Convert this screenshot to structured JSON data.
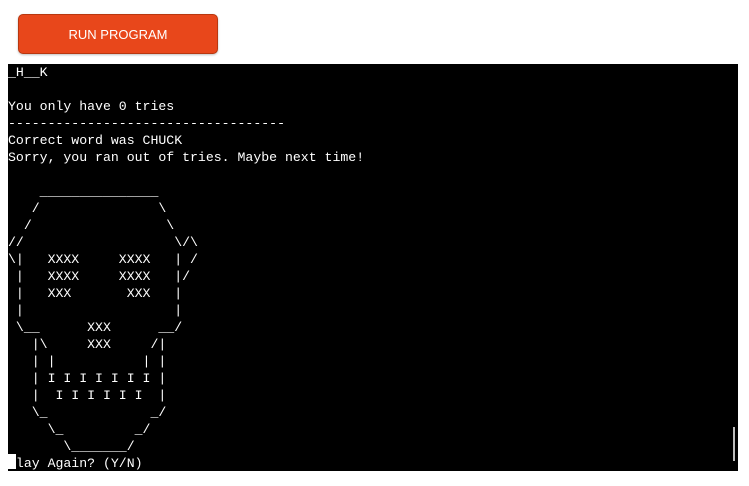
{
  "run_button": {
    "label": "RUN PROGRAM"
  },
  "terminal": {
    "lines": [
      "_H__K",
      "",
      "You only have 0 tries",
      "-----------------------------------",
      "Correct word was CHUCK",
      "Sorry, you ran out of tries. Maybe next time!",
      "",
      "    _______________",
      "   /               \\",
      "  /                 \\",
      "//                   \\/\\",
      "\\|   XXXX     XXXX   | /",
      " |   XXXX     XXXX   |/",
      " |   XXX       XXX   |",
      " |                   |",
      " \\__      XXX      __/",
      "   |\\     XXX     /|",
      "   | |           | |",
      "   | I I I I I I I |",
      "   |  I I I I I I  |",
      "   \\_             _/",
      "     \\_         _/",
      "       \\_______/",
      "Play Again? (Y/N)"
    ]
  },
  "colors": {
    "button_bg": "#e8471b",
    "terminal_bg": "#000000",
    "terminal_fg": "#ffffff"
  }
}
